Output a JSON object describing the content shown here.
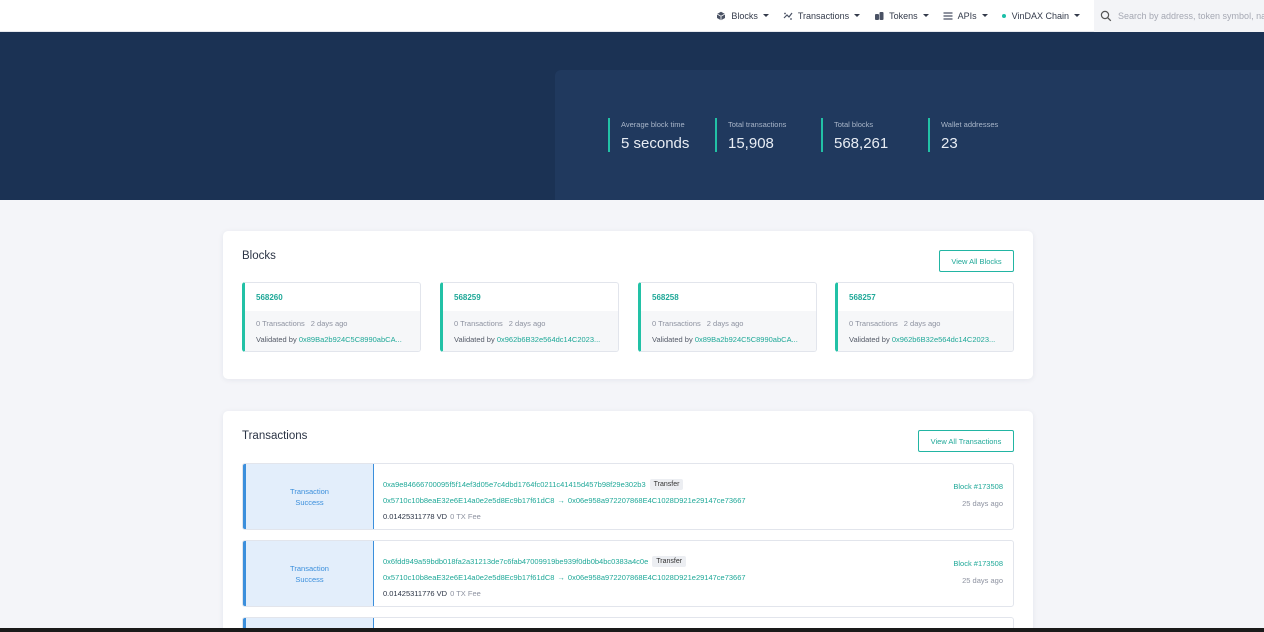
{
  "nav": {
    "items": [
      {
        "label": "Blocks",
        "icon": "cube-icon"
      },
      {
        "label": "Transactions",
        "icon": "transfer-icon"
      },
      {
        "label": "Tokens",
        "icon": "coins-icon"
      },
      {
        "label": "APIs",
        "icon": "list-icon"
      }
    ],
    "chain_label": "VinDAX Chain",
    "search_placeholder": "Search by address, token symbol, name, transaction hash, or block number"
  },
  "stats": [
    {
      "label": "Average block time",
      "value": "5 seconds"
    },
    {
      "label": "Total transactions",
      "value": "15,908"
    },
    {
      "label": "Total blocks",
      "value": "568,261"
    },
    {
      "label": "Wallet addresses",
      "value": "23"
    }
  ],
  "blocks": {
    "title": "Blocks",
    "view_all": "View All Blocks",
    "items": [
      {
        "number": "568260",
        "tx": "0 Transactions",
        "age": "2 days ago",
        "validated_label": "Validated by",
        "validator": "0x89Ba2b924C5C8990abCA..."
      },
      {
        "number": "568259",
        "tx": "0 Transactions",
        "age": "2 days ago",
        "validated_label": "Validated by",
        "validator": "0x962b6B32e564dc14C2023..."
      },
      {
        "number": "568258",
        "tx": "0 Transactions",
        "age": "2 days ago",
        "validated_label": "Validated by",
        "validator": "0x89Ba2b924C5C8990abCA..."
      },
      {
        "number": "568257",
        "tx": "0 Transactions",
        "age": "2 days ago",
        "validated_label": "Validated by",
        "validator": "0x962b6B32e564dc14C2023..."
      }
    ]
  },
  "transactions": {
    "title": "Transactions",
    "view_all": "View All Transactions",
    "items": [
      {
        "status_line1": "Transaction",
        "status_line2": "Success",
        "hash": "0xa9e84666700095f5f14ef3d05e7c4dbd1764fc0211c41415d457b98f29e302b3",
        "type": "Transfer",
        "from": "0x5710c10b8eaE32e6E14a0e2e5d8Ec9b17f61dC8",
        "arrow": "→",
        "to": "0x06e958a972207868E4C1028D921e29147ce73667",
        "value": "0.01425311778 VD",
        "fee": "0 TX Fee",
        "block": "Block #173508",
        "age": "25 days ago"
      },
      {
        "status_line1": "Transaction",
        "status_line2": "Success",
        "hash": "0x6fdd949a59bdb018fa2a31213de7c6fab47009919be939f0db0b4bc0383a4c0e",
        "type": "Transfer",
        "from": "0x5710c10b8eaE32e6E14a0e2e5d8Ec9b17f61dC8",
        "arrow": "→",
        "to": "0x06e958a972207868E4C1028D921e29147ce73667",
        "value": "0.01425311776 VD",
        "fee": "0 TX Fee",
        "block": "Block #173508",
        "age": "25 days ago"
      }
    ]
  },
  "colors": {
    "hero": "#1b3254",
    "stats_panel": "#20395e",
    "accent": "#22c1a6",
    "link": "#1fa898",
    "tx_status": "#3b8fdc"
  }
}
